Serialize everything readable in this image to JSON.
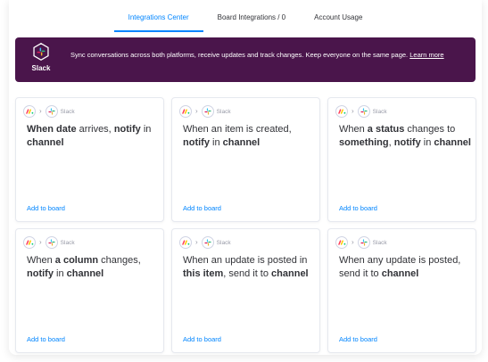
{
  "tabs": [
    {
      "label": "Integrations Center",
      "active": true
    },
    {
      "label": "Board Integrations / 0",
      "active": false
    },
    {
      "label": "Account Usage",
      "active": false
    }
  ],
  "banner": {
    "app_name": "Slack",
    "description": "Sync conversations across both platforms, receive updates and track changes. Keep everyone on the same page.",
    "link_text": "Learn more",
    "background_color": "#4a154b"
  },
  "cards": [
    {
      "app": "Slack",
      "link": "Add to board",
      "parts": [
        {
          "text": "When ",
          "bold": true
        },
        {
          "text": "date",
          "bold": true
        },
        {
          "text": " arrives, ",
          "bold": false
        },
        {
          "text": "notify",
          "bold": true
        },
        {
          "text": " in ",
          "bold": false
        },
        {
          "text": "channel",
          "bold": true
        }
      ]
    },
    {
      "app": "Slack",
      "link": "Add to board",
      "parts": [
        {
          "text": "When an item is created, ",
          "bold": false
        },
        {
          "text": "notify",
          "bold": true
        },
        {
          "text": " in ",
          "bold": false
        },
        {
          "text": "channel",
          "bold": true
        }
      ]
    },
    {
      "app": "Slack",
      "link": "Add to board",
      "parts": [
        {
          "text": "When ",
          "bold": false
        },
        {
          "text": "a status",
          "bold": true
        },
        {
          "text": " changes to ",
          "bold": false
        },
        {
          "text": "something",
          "bold": true
        },
        {
          "text": ", ",
          "bold": false
        },
        {
          "text": "notify",
          "bold": true
        },
        {
          "text": " in ",
          "bold": false
        },
        {
          "text": "channel",
          "bold": true
        }
      ]
    },
    {
      "app": "Slack",
      "link": "Add to board",
      "parts": [
        {
          "text": "When ",
          "bold": false
        },
        {
          "text": "a column",
          "bold": true
        },
        {
          "text": " changes, ",
          "bold": false
        },
        {
          "text": "notify",
          "bold": true
        },
        {
          "text": " in ",
          "bold": false
        },
        {
          "text": "channel",
          "bold": true
        }
      ]
    },
    {
      "app": "Slack",
      "link": "Add to board",
      "parts": [
        {
          "text": "When an update is posted in ",
          "bold": false
        },
        {
          "text": "this item",
          "bold": true
        },
        {
          "text": ", send it to ",
          "bold": false
        },
        {
          "text": "channel",
          "bold": true
        }
      ]
    },
    {
      "app": "Slack",
      "link": "Add to board",
      "parts": [
        {
          "text": "When any update is posted, send it to ",
          "bold": false
        },
        {
          "text": "channel",
          "bold": true
        }
      ]
    }
  ],
  "colors": {
    "accent": "#0085ff",
    "monday_red": "#ff3d57",
    "monday_yellow": "#ffcb00",
    "monday_green": "#00ca72"
  },
  "icons": {
    "monday": "monday-logo-icon",
    "slack": "slack-logo-icon",
    "arrow": "chevron-right-icon"
  }
}
